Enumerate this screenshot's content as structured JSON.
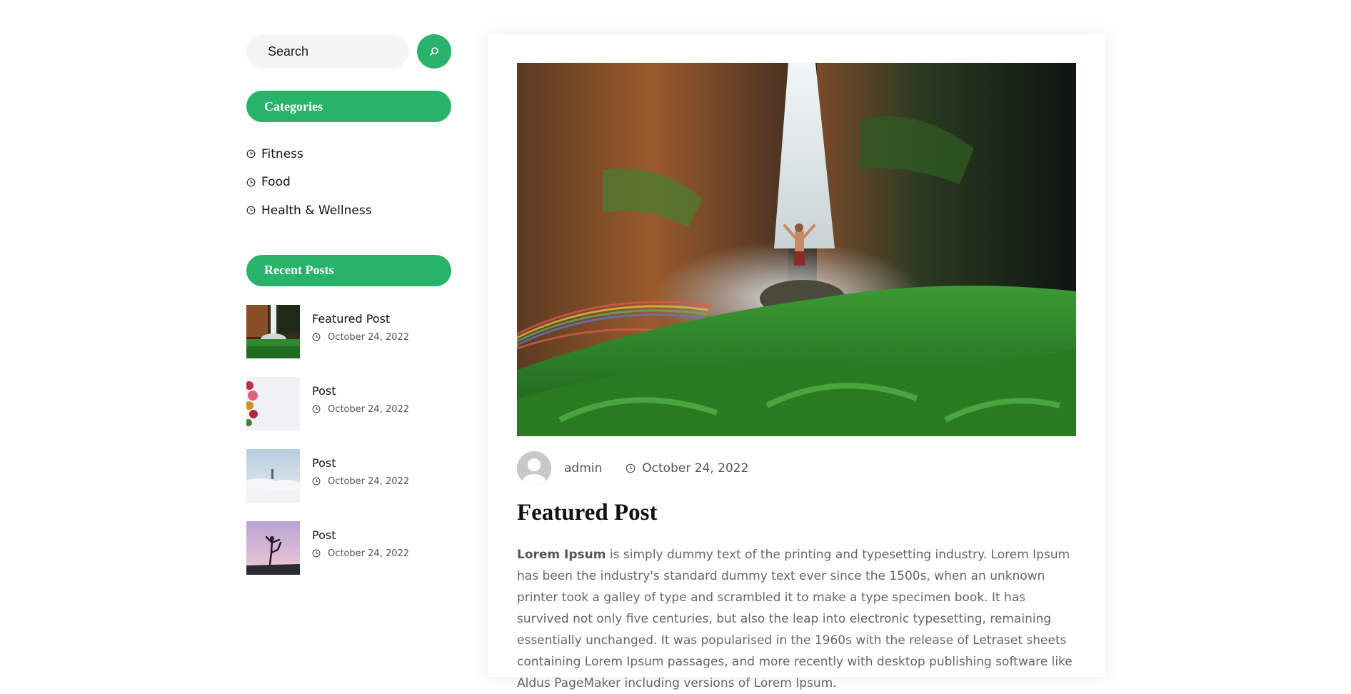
{
  "sidebar": {
    "search": {
      "placeholder": "Search"
    },
    "categories_title": "Categories",
    "categories": [
      {
        "label": "Fitness"
      },
      {
        "label": "Food"
      },
      {
        "label": "Health & Wellness"
      }
    ],
    "recent_title": "Recent Posts",
    "recent_posts": [
      {
        "title": "Featured Post",
        "date": "October 24, 2022"
      },
      {
        "title": "Post",
        "date": "October 24, 2022"
      },
      {
        "title": "Post",
        "date": "October 24, 2022"
      },
      {
        "title": "Post",
        "date": "October 24, 2022"
      }
    ]
  },
  "post": {
    "author": "admin",
    "date": "October 24, 2022",
    "title": "Featured Post",
    "body_lead": "Lorem Ipsum",
    "body_text": " is simply dummy text of the printing and typesetting industry. Lorem Ipsum has been the industry's standard dummy text ever since the 1500s, when an unknown printer took a galley of type and scrambled it to make a type specimen book. It has survived not only five centuries, but also the leap into electronic typesetting, remaining essentially unchanged. It was popularised in the 1960s with the release of Letraset sheets containing Lorem Ipsum passages, and more recently with desktop publishing software like Aldus PageMaker including versions of Lorem Ipsum."
  },
  "icons": {
    "search": "search-icon",
    "clock": "clock-icon",
    "avatar": "user-avatar-icon"
  },
  "colors": {
    "accent": "#28b26a",
    "text": "#111111",
    "muted": "#666666"
  }
}
